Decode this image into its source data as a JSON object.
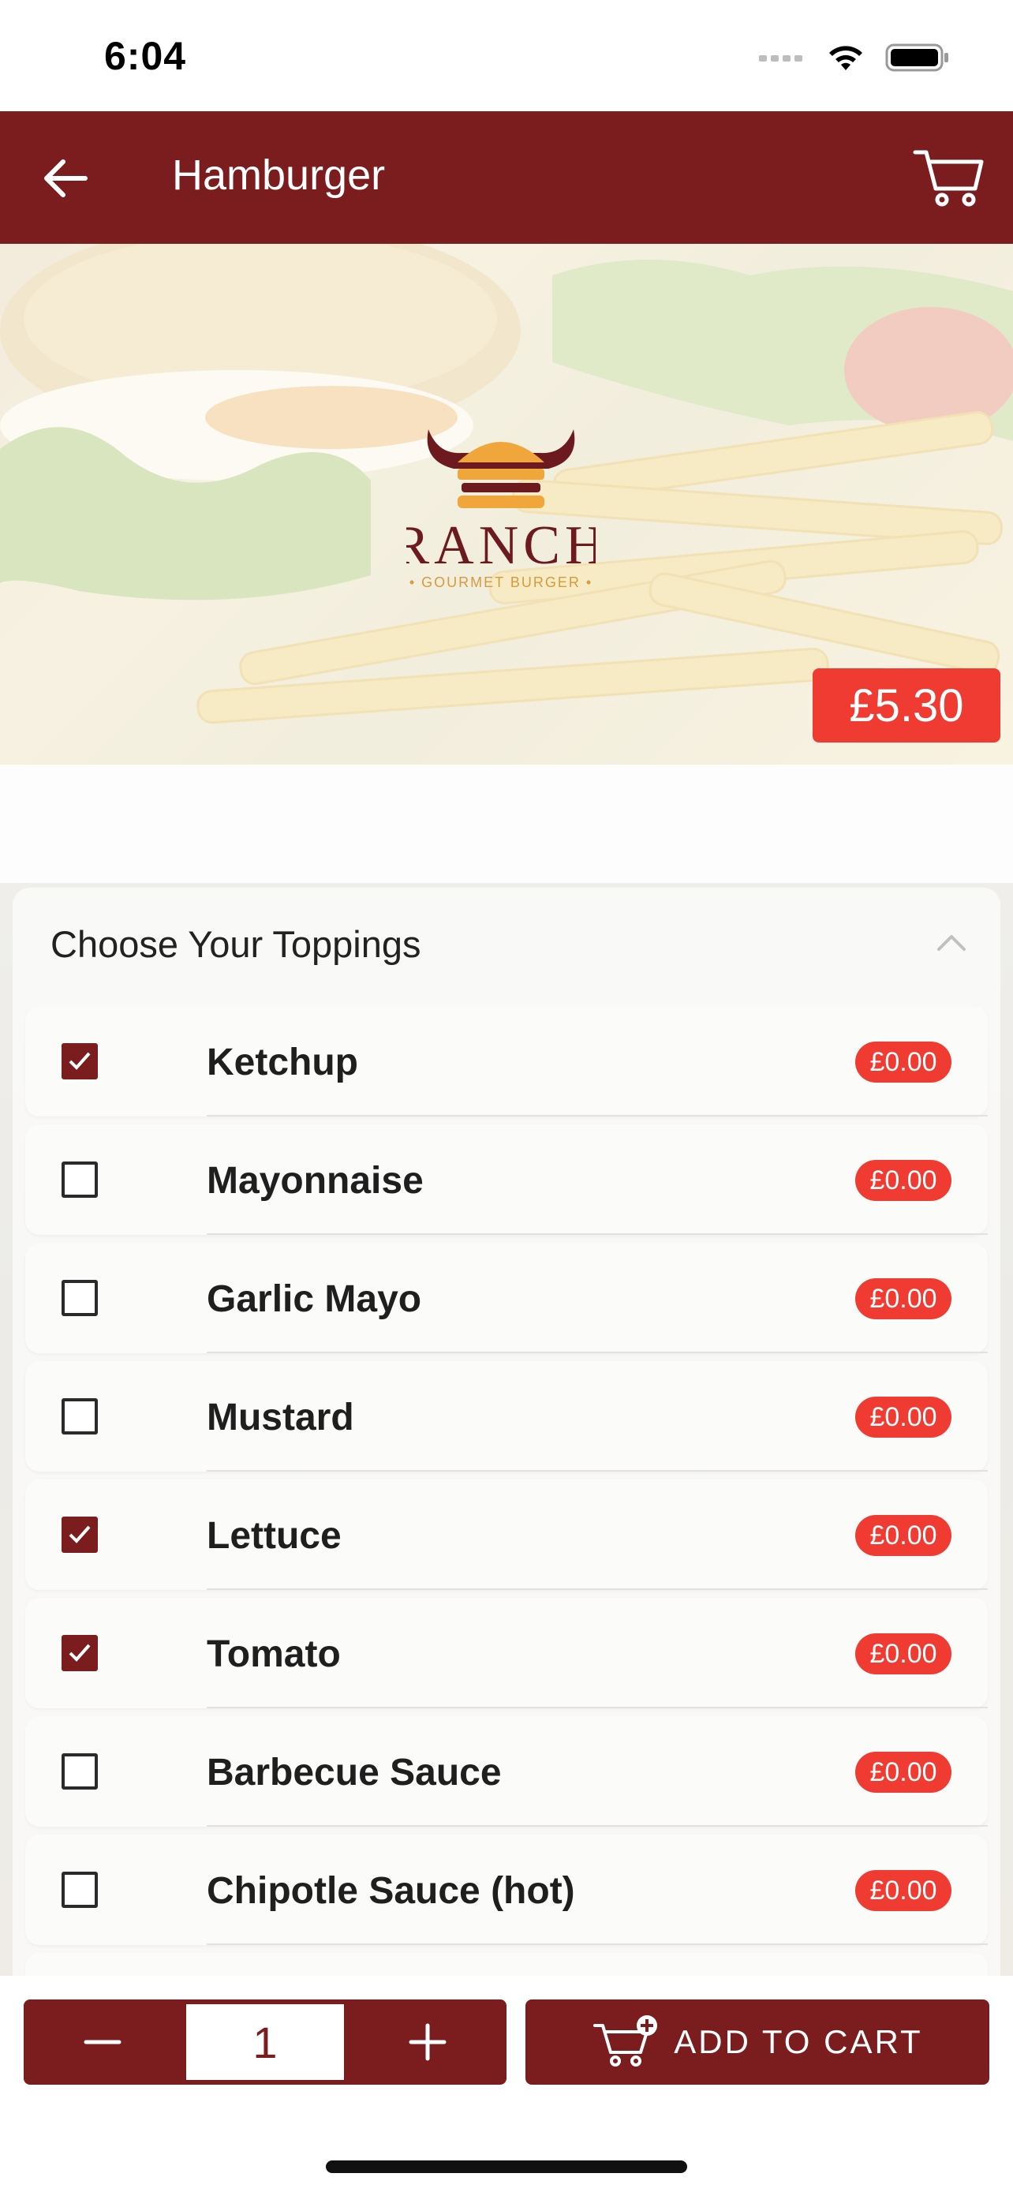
{
  "status_bar": {
    "time": "6:04"
  },
  "app_bar": {
    "title": "Hamburger",
    "back_icon": "arrow-left-icon",
    "cart_icon": "cart-icon"
  },
  "hero": {
    "price": "£5.30",
    "logo_text": "RANCH",
    "logo_subtext": "GOURMET BURGER"
  },
  "toppings": {
    "title": "Choose Your Toppings",
    "items": [
      {
        "label": "Ketchup",
        "price": "£0.00",
        "checked": true
      },
      {
        "label": "Mayonnaise",
        "price": "£0.00",
        "checked": false
      },
      {
        "label": "Garlic Mayo",
        "price": "£0.00",
        "checked": false
      },
      {
        "label": "Mustard",
        "price": "£0.00",
        "checked": false
      },
      {
        "label": "Lettuce",
        "price": "£0.00",
        "checked": true
      },
      {
        "label": "Tomato",
        "price": "£0.00",
        "checked": true
      },
      {
        "label": "Barbecue Sauce",
        "price": "£0.00",
        "checked": false
      },
      {
        "label": "Chipotle Sauce (hot)",
        "price": "£0.00",
        "checked": false
      }
    ]
  },
  "bottom_bar": {
    "quantity": "1",
    "add_to_cart": "ADD TO CART"
  },
  "colors": {
    "brand": "#7b1c1e",
    "price_badge": "#ef3b31"
  }
}
